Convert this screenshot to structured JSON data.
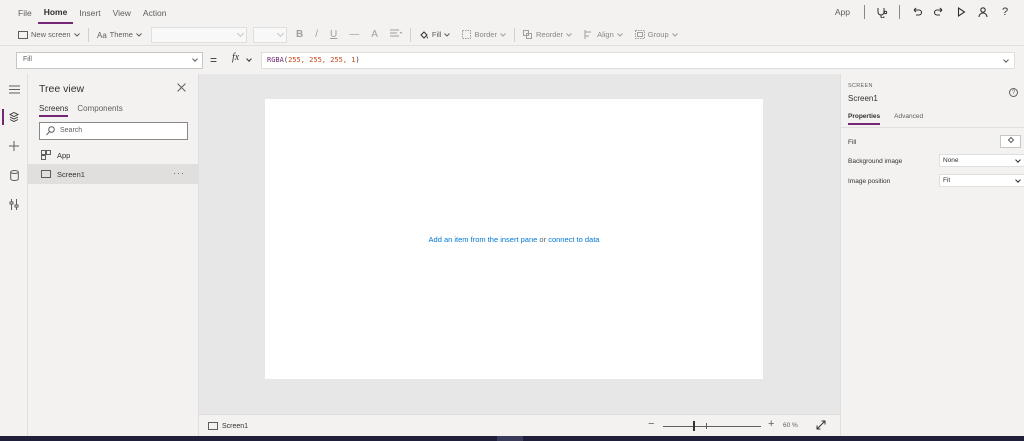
{
  "menu": {
    "items": [
      {
        "label": "File",
        "active": false
      },
      {
        "label": "Home",
        "active": true
      },
      {
        "label": "Insert",
        "active": false
      },
      {
        "label": "View",
        "active": false
      },
      {
        "label": "Action",
        "active": false
      }
    ],
    "app_label": "App"
  },
  "toolbar": {
    "new_screen": "New screen",
    "theme": "Theme",
    "bold": "B",
    "italic": "/",
    "underline": "U",
    "strikethrough": "—",
    "font_size_glyph": "A",
    "fill": "Fill",
    "border": "Border",
    "reorder": "Reorder",
    "align": "Align",
    "group": "Group"
  },
  "formula": {
    "property": "Fill",
    "fn": "RGBA",
    "args": "255, 255, 255, 1",
    "open": "(",
    "close": ")"
  },
  "tree": {
    "title": "Tree view",
    "tabs": [
      "Screens",
      "Components"
    ],
    "search_placeholder": "Search",
    "items": [
      {
        "label": "App",
        "selected": false
      },
      {
        "label": "Screen1",
        "selected": true,
        "more": "···"
      }
    ]
  },
  "canvas": {
    "hint_link1": "Add an item from the insert pane",
    "hint_or": "or",
    "hint_link2": "connect to data"
  },
  "bottombar": {
    "screen_name": "Screen1",
    "zoom_value": "60",
    "zoom_unit": "%",
    "zoom_minus": "−",
    "zoom_plus": "+"
  },
  "rightpane": {
    "category": "SCREEN",
    "name": "Screen1",
    "help": "?",
    "tabs": [
      "Properties",
      "Advanced"
    ],
    "fill_label": "Fill",
    "bg_image_label": "Background image",
    "bg_image_value": "None",
    "img_pos_label": "Image position",
    "img_pos_value": "Fit"
  },
  "colors": {
    "accent": "#742774",
    "link": "#0078d4",
    "chrome": "#f3f2f1",
    "canvas_bg": "#e7e7e7"
  }
}
